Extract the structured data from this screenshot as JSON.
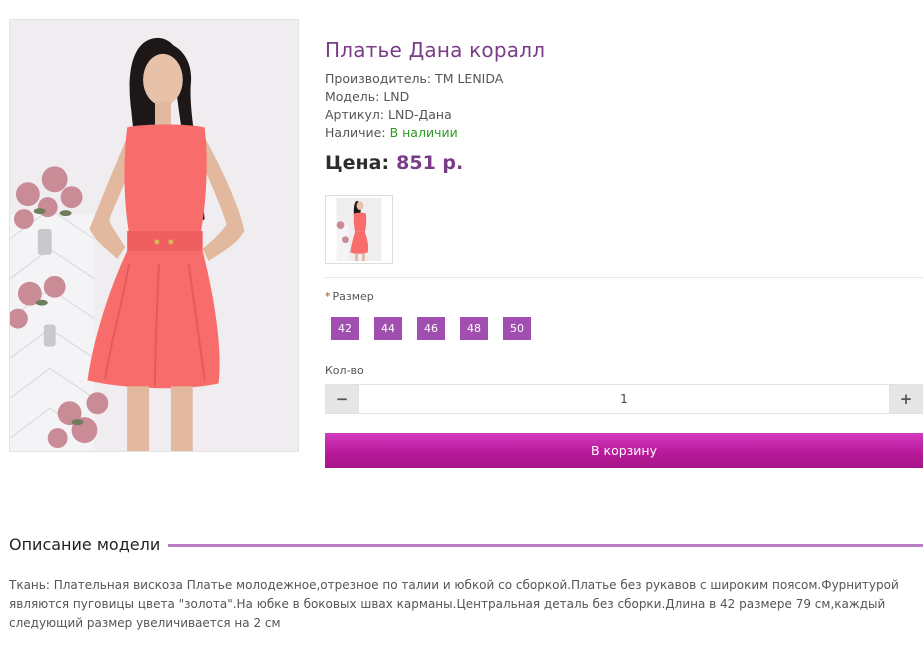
{
  "product": {
    "title": "Платье Дана коралл",
    "manufacturer_label": "Производитель:",
    "manufacturer_value": "TM LENIDA",
    "model_label": "Модель:",
    "model_value": "LND",
    "sku_label": "Артикул:",
    "sku_value": "LND-Дана",
    "availability_label": "Наличие:",
    "availability_value": "В наличии",
    "price_label": "Цена:",
    "price_value": "851 р."
  },
  "options": {
    "required_mark": "*",
    "size_label": "Размер",
    "sizes": [
      "42",
      "44",
      "46",
      "48",
      "50"
    ]
  },
  "quantity": {
    "label": "Кол-во",
    "minus": "−",
    "value": "1",
    "plus": "+"
  },
  "cart": {
    "button_label": "В корзину"
  },
  "description": {
    "title": "Описание модели",
    "text": "Ткань: Плательная вискоза Платье молодежное,отрезное по талии и юбкой со сборкой.Платье без рукавов с широким поясом.Фурнитурой являются пуговицы цвета \"золота\".На юбке в боковых швах карманы.Центральная деталь без сборки.Длина в 42 размере 79 см,каждый следующий размер увеличивается на 2 см"
  },
  "colors": {
    "accent_purple": "#7a3c86",
    "size_button": "#a04fb0",
    "cart_button": "#b91a9a",
    "in_stock": "#2a9b20",
    "dress": "#f96c6c"
  }
}
